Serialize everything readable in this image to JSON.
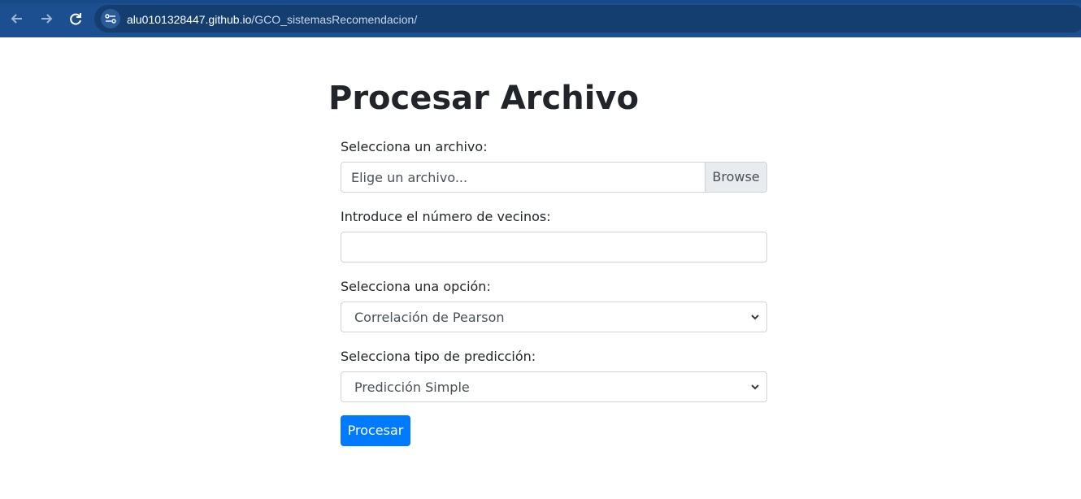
{
  "browser": {
    "url_host": "alu0101328447.github.io",
    "url_path": "/GCO_sistemasRecomendacion/",
    "icons": {
      "back": "back-arrow-icon",
      "forward": "forward-arrow-icon",
      "reload": "reload-icon",
      "site": "site-info-icon"
    }
  },
  "page": {
    "title": "Procesar Archivo",
    "file": {
      "label": "Selecciona un archivo:",
      "placeholder": "Elige un archivo...",
      "browse_label": "Browse"
    },
    "neighbors": {
      "label": "Introduce el número de vecinos:",
      "value": ""
    },
    "option": {
      "label": "Selecciona una opción:",
      "selected": "Correlación de Pearson"
    },
    "prediction": {
      "label": "Selecciona tipo de predicción:",
      "selected": "Predicción Simple"
    },
    "submit_label": "Procesar"
  },
  "colors": {
    "browser_bar": "#1c4f8f",
    "primary_button": "#007bff"
  }
}
